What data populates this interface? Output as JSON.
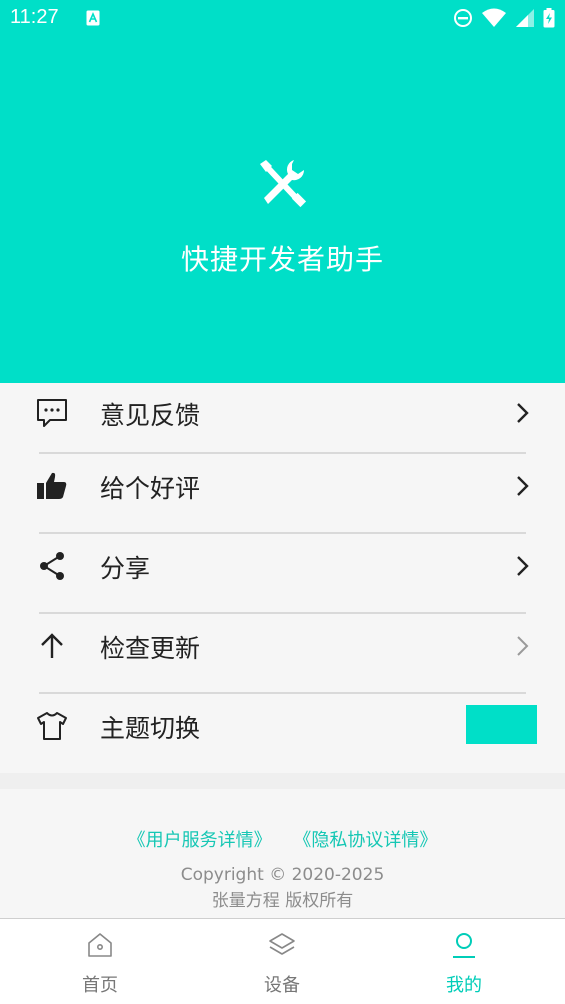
{
  "status_bar": {
    "time": "11:27"
  },
  "header": {
    "title": "快捷开发者助手",
    "background_color": "#00dfc8",
    "logo_icon": "tools-icon"
  },
  "menu": {
    "items": [
      {
        "label": "意见反馈",
        "icon": "feedback-icon"
      },
      {
        "label": "给个好评",
        "icon": "thumbs-up-icon"
      },
      {
        "label": "分享",
        "icon": "share-icon"
      },
      {
        "label": "检查更新",
        "icon": "arrow-up-icon"
      },
      {
        "label": "主题切换",
        "icon": "tshirt-icon",
        "theme_color": "#00dfc8"
      }
    ]
  },
  "footer": {
    "links": [
      "《用户服务详情》",
      "《隐私协议详情》"
    ],
    "link_color": "#16c7b4",
    "copyright": "Copyright © 2020-2025",
    "owner": "张量方程  版权所有"
  },
  "bottom_nav": {
    "items": [
      {
        "label": "首页",
        "icon": "home-icon",
        "active": false
      },
      {
        "label": "设备",
        "icon": "layers-icon",
        "active": false
      },
      {
        "label": "我的",
        "icon": "user-icon",
        "active": true
      }
    ],
    "active_color": "#00cdb8"
  }
}
